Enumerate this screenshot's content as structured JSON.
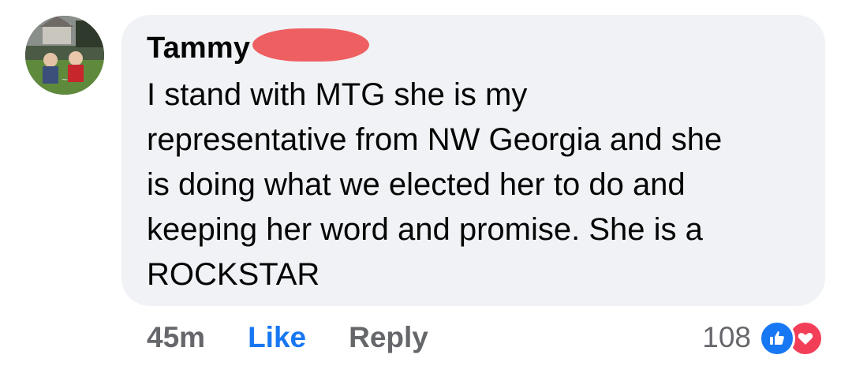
{
  "comment": {
    "author_name": "Tammy",
    "text": "I stand with  MTG she is my\nrepresentative from NW Georgia and she\nis doing what we elected her to do and\nkeeping her word and promise.  She is a\nROCKSTAR",
    "timestamp": "45m",
    "like_label": "Like",
    "reply_label": "Reply",
    "reaction_count": "108",
    "reactions": [
      "like-icon",
      "love-icon"
    ]
  },
  "colors": {
    "bubble_bg": "#f0f2f5",
    "like_blue": "#1877f2",
    "love_red": "#f33e58",
    "meta_gray": "#65676b",
    "redaction": "#ee5f61"
  }
}
